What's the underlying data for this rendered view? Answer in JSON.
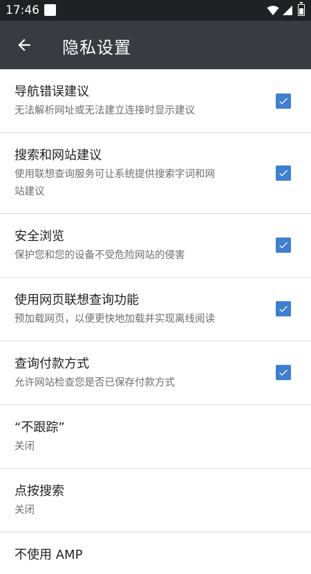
{
  "status_bar": {
    "time": "17:46",
    "icons": [
      "app-notification-icon",
      "wifi-icon",
      "cell-signal-icon",
      "battery-icon"
    ]
  },
  "app_bar": {
    "back_icon": "arrow-back-icon",
    "title": "隐私设置"
  },
  "colors": {
    "status_bar_bg": "#202124",
    "app_bar_bg": "#383c40",
    "checkbox_accent": "#3e7fd1",
    "divider": "#dcdcdc"
  },
  "settings": [
    {
      "title": "导航错误建议",
      "summary": "无法解析网址或无法建立连接时显示建议",
      "checked": true
    },
    {
      "title": "搜索和网站建议",
      "summary_line1": "使用联想查询服务可让系统提供搜索字词和网",
      "summary_line2": "站建议",
      "checked": true
    },
    {
      "title": "安全浏览",
      "summary": "保护您和您的设备不受危险网站的侵害",
      "checked": true
    },
    {
      "title": "使用网页联想查询功能",
      "summary": "预加载网页，以便更快地加载并实现离线阅读",
      "checked": true
    },
    {
      "title": "查询付款方式",
      "summary": "允许网站检查您是否已保存付款方式",
      "checked": true
    },
    {
      "title": "“不跟踪”",
      "summary": "关闭"
    },
    {
      "title": "点按搜索",
      "summary": "关闭"
    },
    {
      "title": "不使用 AMP"
    }
  ]
}
